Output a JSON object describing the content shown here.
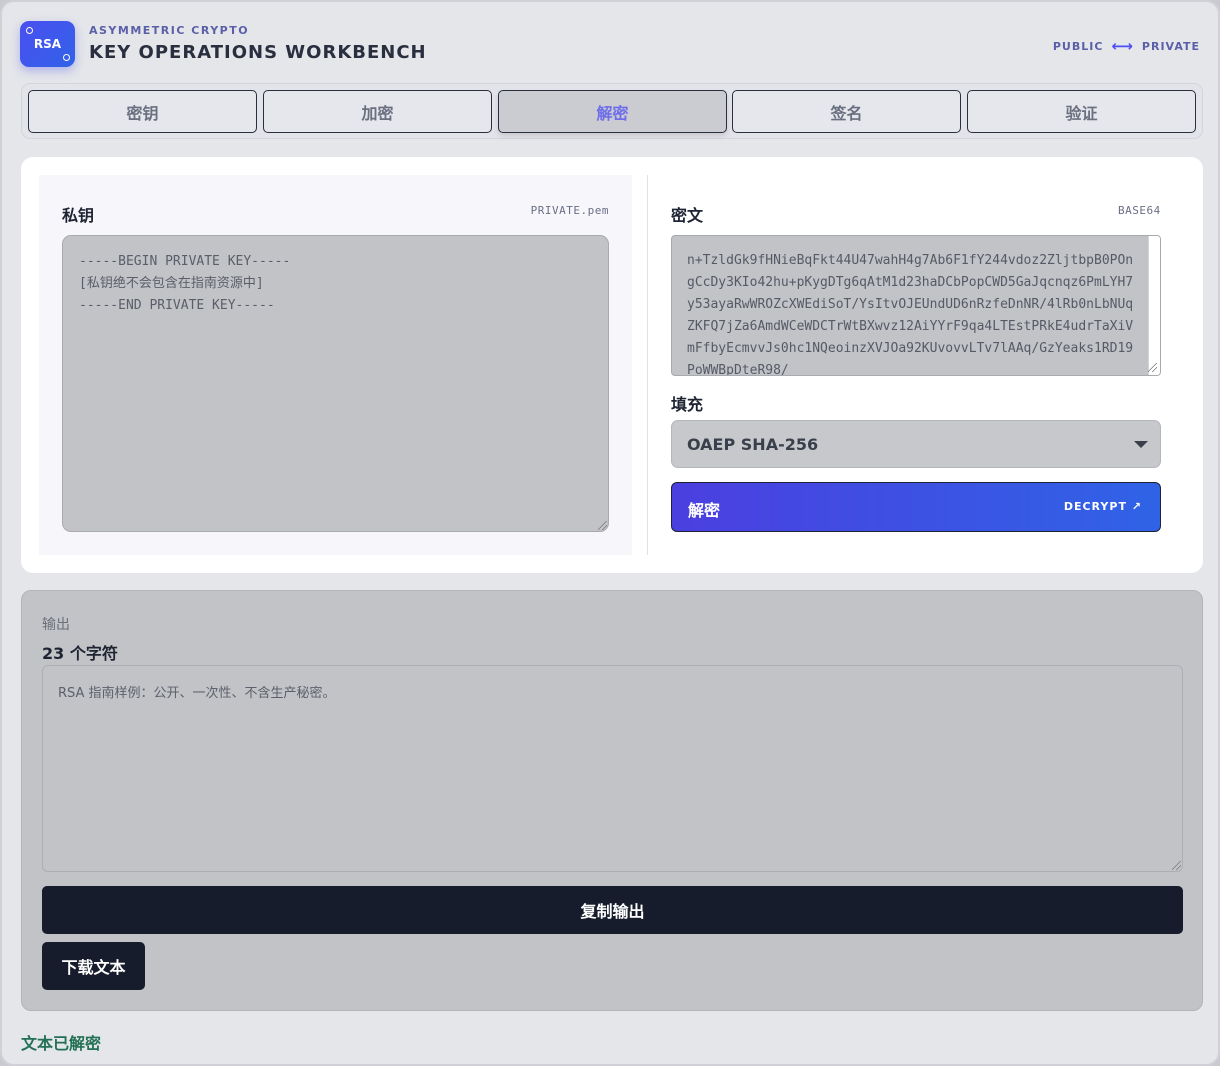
{
  "header": {
    "logo_text": "RSA",
    "eyebrow": "ASYMMETRIC CRYPTO",
    "title": "KEY OPERATIONS WORKBENCH",
    "right_left": "PUBLIC",
    "right_right": "PRIVATE"
  },
  "tabs": [
    {
      "label": "密钥",
      "active": false
    },
    {
      "label": "加密",
      "active": false
    },
    {
      "label": "解密",
      "active": true
    },
    {
      "label": "签名",
      "active": false
    },
    {
      "label": "验证",
      "active": false
    }
  ],
  "private_key": {
    "label": "私钥",
    "tag": "PRIVATE.pem",
    "value": "-----BEGIN PRIVATE KEY-----\n[私钥绝不会包含在指南资源中]\n-----END PRIVATE KEY-----"
  },
  "ciphertext": {
    "label": "密文",
    "tag": "BASE64",
    "value": "n+TzldGk9fHNieBqFkt44U47wahH4g7Ab6F1fY244vdoz2ZljtbpB0POngCcDy3KIo42hu+pKygDTg6qAtM1d23haDCbPopCWD5GaJqcnqz6PmLYH7y53ayaRwWROZcXWEdiSoT/YsItvOJEUndUD6nRzfeDnNR/4lRb0nLbNUqZKFQ7jZa6AmdWCeWDCTrWtBXwvz12AiYYrF9qa4LTEstPRkE4udrTaXiVmFfbyEcmvvJs0hc1NQeoinzXVJOa92KUvovvLTv7lAAq/GzYeaks1RD19PoWWBpDteR98/"
  },
  "padding": {
    "label": "填充",
    "selected": "OAEP SHA-256"
  },
  "decrypt_button": {
    "label": "解密",
    "sublabel": "DECRYPT ↗"
  },
  "output": {
    "eyebrow": "输出",
    "count": "23 个字符",
    "value": "RSA 指南样例：公开、一次性、不含生产秘密。",
    "copy_label": "复制输出",
    "download_label": "下载文本"
  },
  "status": "文本已解密"
}
